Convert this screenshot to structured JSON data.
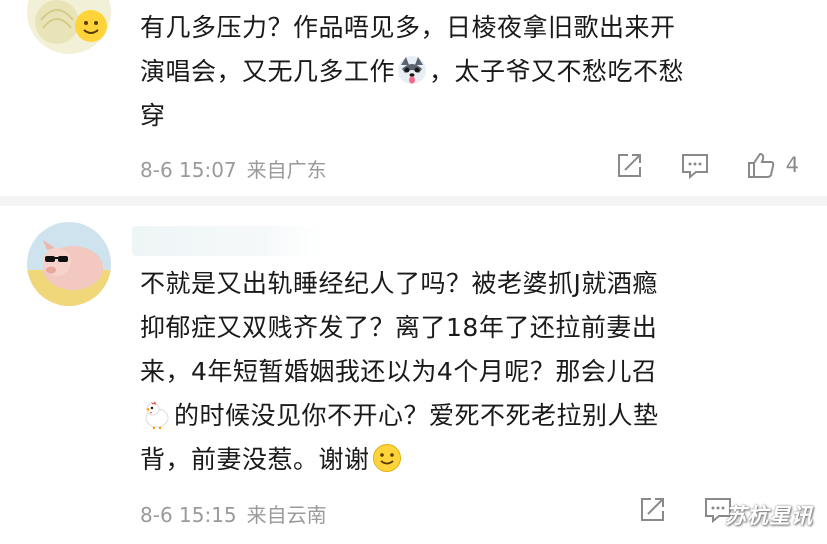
{
  "comments": [
    {
      "text_lines": [
        "有几多压力？作品唔见多，日棱夜拿旧歌出来开",
        "演唱会，又无几多工作",
        "，太子爷又不愁吃不愁",
        "穿"
      ],
      "time": "8-6 15:07",
      "location": "来自广东",
      "likes": "4"
    },
    {
      "text_lines": [
        "不就是又出轨睡经纪人了吗？被老婆抓J就酒瘾",
        "抑郁症又双贱齐发了？离了18年了还拉前妻出",
        "来，4年短暂婚姻我还以为4个月呢？那会儿召",
        "的时候没见你不开心？爱死不死老拉别人垫",
        "背，前妻没惹。谢谢"
      ],
      "time": "8-6 15:15",
      "location": "来自云南",
      "likes": ""
    }
  ],
  "watermark": "苏杭星讯",
  "icons": {
    "share": "share-icon",
    "comment": "comment-icon",
    "like": "thumbs-up-icon",
    "dog_emoji": "husky-emoji-icon",
    "chicken_emoji": "chicken-emoji-icon",
    "smile_emoji": "smile-emoji-icon"
  }
}
